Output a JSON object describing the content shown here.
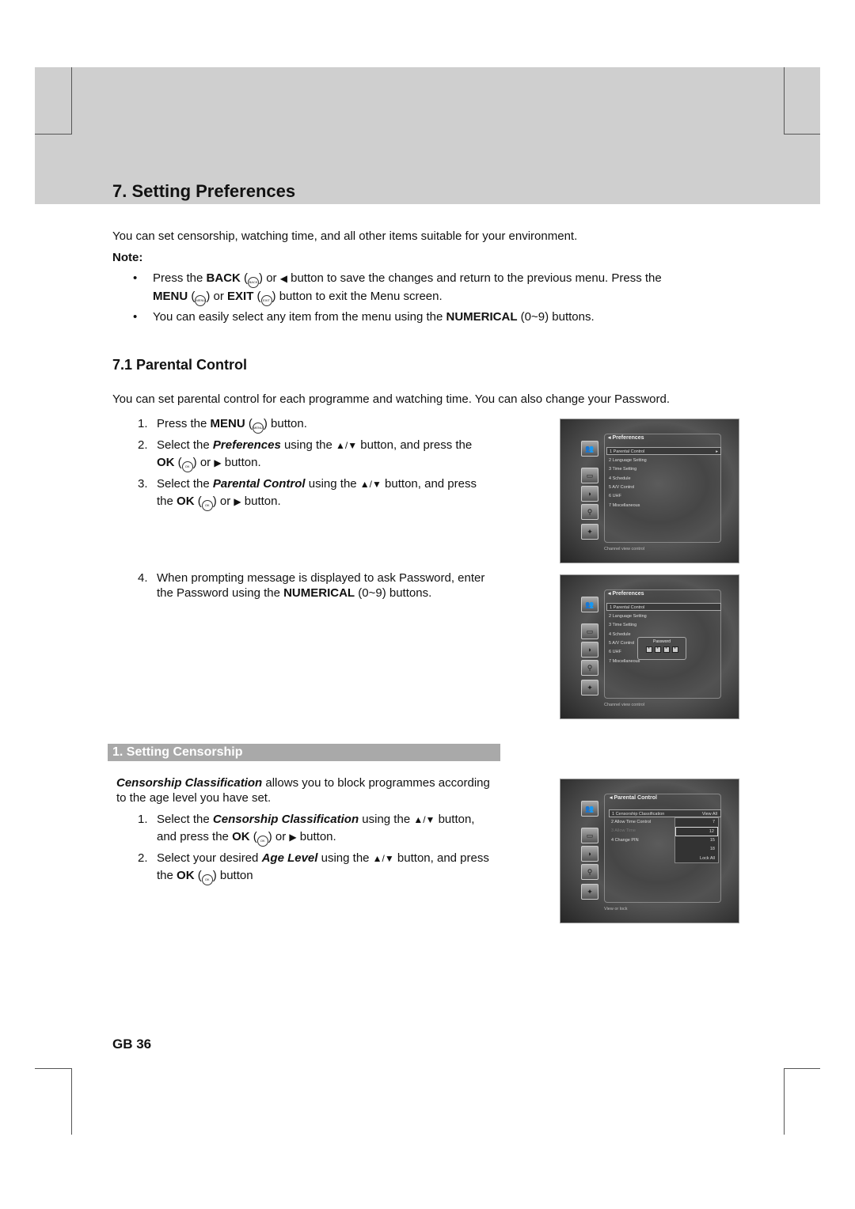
{
  "page_title": "7. Setting Preferences",
  "intro": "You can set censorship, watching time, and all other items suitable for your environment.",
  "note_label": "Note:",
  "notes": [
    {
      "s0": "Press the ",
      "s1": "BACK",
      "s2": " (",
      "icon1": "BACK",
      "s3": ") or ",
      "arrow": "◀",
      "s4": " button to save the changes and return to the previous menu. Press the",
      "s5": "MENU",
      "s6": " (",
      "icon2": "MENU",
      "s7": ") or ",
      "s8": "EXIT",
      "s9": " (",
      "icon3": "EXIT",
      "s10": ") button to exit the Menu screen."
    },
    {
      "s0": "You can easily select any item from the menu using the ",
      "s1": "NUMERICAL",
      "s2": " (0~9) buttons."
    }
  ],
  "section": {
    "title": "7.1 Parental Control",
    "intro": "You can set parental control for each programme and watching time. You can also change your Password.",
    "steps": [
      {
        "n": "1.",
        "a": "Press the ",
        "b": "MENU",
        "c": " (",
        "icon": "MENU",
        "d": ") button."
      },
      {
        "n": "2.",
        "a": "Select the ",
        "b": "Preferences",
        "c": " using the ",
        "arrows": "▲/▼",
        "d": " button, and press the",
        "e": "OK",
        "f": " (",
        "icon": "OK",
        "g": ") or ",
        "arrow": "▶",
        "h": " button."
      },
      {
        "n": "3.",
        "a": "Select the ",
        "b": "Parental Control",
        "c": " using the ",
        "arrows": "▲/▼",
        "d": " button, and press",
        "e": "the ",
        "f": "OK",
        "g": " (",
        "icon": "OK",
        "h": ") or ",
        "arrow": "▶",
        "i": " button."
      },
      {
        "n": "4.",
        "a": "When prompting message is displayed to ask Password, enter",
        "b": "the Password using the ",
        "c": "NUMERICAL",
        "d": " (0~9) buttons."
      }
    ]
  },
  "subsection": {
    "title": "1. Setting Censorship",
    "intro_b": "Censorship Classification",
    "intro_a": " allows you to block programmes according",
    "intro_c": "to the age level you have set.",
    "steps": [
      {
        "n": "1.",
        "a": "Select the ",
        "b": "Censorship Classification",
        "c": " using the ",
        "arrows": "▲/▼",
        "d": " button,",
        "e": "and press the ",
        "f": "OK",
        "g": " (",
        "icon": "OK",
        "h": ") or ",
        "arrow": "▶",
        "i": " button."
      },
      {
        "n": "2.",
        "a": "Select your desired ",
        "b": "Age Level",
        "c": " using the ",
        "arrows": "▲/▼",
        "d": " button, and press",
        "e": "the ",
        "f": "OK",
        "g": " (",
        "icon": "OK",
        "h": ") button"
      }
    ]
  },
  "screens": {
    "prefs": {
      "title": "◂ Preferences",
      "items": [
        "1 Parental Control",
        "2 Language Setting",
        "3 Time Setting",
        "4 Schedule",
        "5 A/V Control",
        "6 UHF",
        "7 Miscellaneous"
      ],
      "sel_arrow": "▸",
      "footer": "Channel view control"
    },
    "password": {
      "label": "Password",
      "digits": [
        "*",
        "*",
        "*",
        "*"
      ]
    },
    "parental": {
      "title": "◂ Parental Control",
      "items": [
        "1 Censorship Classification",
        "2 Allow Time Control",
        "3 Allow Time",
        "4 Change PIN"
      ],
      "current": "View All",
      "options": [
        "7",
        "12",
        "15",
        "18",
        "Lock All"
      ],
      "selected": "12",
      "footer": "View or lock"
    }
  },
  "page_number": "GB 36"
}
